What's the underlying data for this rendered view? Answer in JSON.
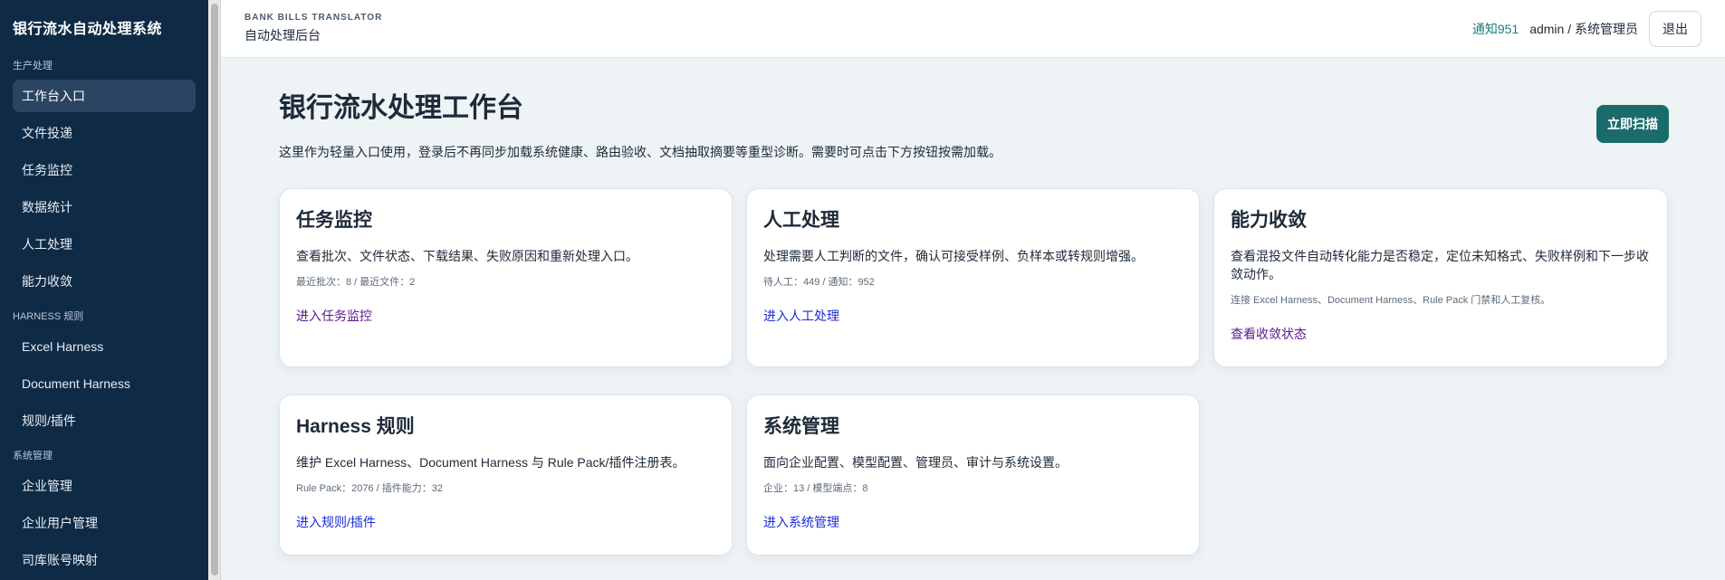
{
  "sidebar": {
    "brand": "银行流水自动处理系统",
    "sections": [
      {
        "title": "生产处理",
        "items": [
          "工作台入口",
          "文件投递",
          "任务监控",
          "数据统计",
          "人工处理",
          "能力收敛"
        ]
      },
      {
        "title": "HARNESS 规则",
        "items": [
          "Excel Harness",
          "Document Harness",
          "规则/插件"
        ]
      },
      {
        "title": "系统管理",
        "items": [
          "企业管理",
          "企业用户管理",
          "司库账号映射"
        ]
      }
    ],
    "active_item": "工作台入口"
  },
  "topbar": {
    "kicker": "BANK BILLS TRANSLATOR",
    "subtitle": "自动处理后台",
    "notify": "通知951",
    "user": "admin / 系统管理员",
    "logout": "退出"
  },
  "page": {
    "title": "银行流水处理工作台",
    "description": "这里作为轻量入口使用，登录后不再同步加载系统健康、路由验收、文档抽取摘要等重型诊断。需要时可点击下方按钮按需加载。",
    "scan_button": "立即扫描"
  },
  "cards": [
    {
      "title": "任务监控",
      "desc": "查看批次、文件状态、下载结果、失败原因和重新处理入口。",
      "meta": "最近批次：8 / 最近文件：2",
      "link": "进入任务监控"
    },
    {
      "title": "人工处理",
      "desc": "处理需要人工判断的文件，确认可接受样例、负样本或转规则增强。",
      "meta": "待人工：449 / 通知：952",
      "link": "进入人工处理"
    },
    {
      "title": "能力收敛",
      "desc": "查看混投文件自动转化能力是否稳定，定位未知格式、失败样例和下一步收敛动作。",
      "meta": "连接 Excel Harness、Document Harness、Rule Pack 门禁和人工复核。",
      "link": "查看收敛状态"
    },
    {
      "title": "Harness 规则",
      "desc": "维护 Excel Harness、Document Harness 与 Rule Pack/插件注册表。",
      "meta": "Rule Pack：2076 / 插件能力：32",
      "link": "进入规则/插件"
    },
    {
      "title": "系统管理",
      "desc": "面向企业配置、模型配置、管理员、审计与系统设置。",
      "meta": "企业：13 / 模型端点：8",
      "link": "进入系统管理"
    }
  ]
}
